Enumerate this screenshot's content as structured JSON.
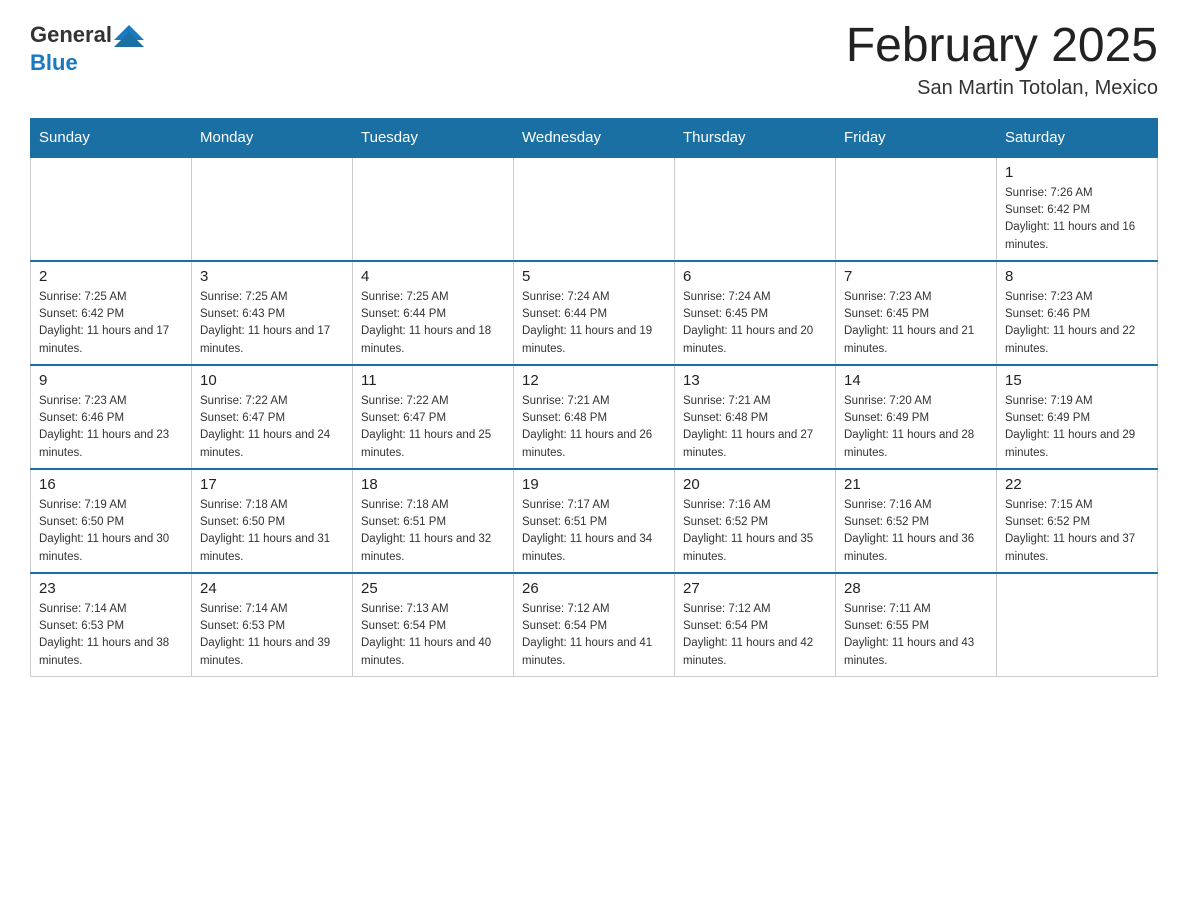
{
  "header": {
    "logo_general": "General",
    "logo_blue": "Blue",
    "month": "February 2025",
    "location": "San Martin Totolan, Mexico"
  },
  "weekdays": [
    "Sunday",
    "Monday",
    "Tuesday",
    "Wednesday",
    "Thursday",
    "Friday",
    "Saturday"
  ],
  "weeks": [
    [
      {
        "day": "",
        "sunrise": "",
        "sunset": "",
        "daylight": ""
      },
      {
        "day": "",
        "sunrise": "",
        "sunset": "",
        "daylight": ""
      },
      {
        "day": "",
        "sunrise": "",
        "sunset": "",
        "daylight": ""
      },
      {
        "day": "",
        "sunrise": "",
        "sunset": "",
        "daylight": ""
      },
      {
        "day": "",
        "sunrise": "",
        "sunset": "",
        "daylight": ""
      },
      {
        "day": "",
        "sunrise": "",
        "sunset": "",
        "daylight": ""
      },
      {
        "day": "1",
        "sunrise": "Sunrise: 7:26 AM",
        "sunset": "Sunset: 6:42 PM",
        "daylight": "Daylight: 11 hours and 16 minutes."
      }
    ],
    [
      {
        "day": "2",
        "sunrise": "Sunrise: 7:25 AM",
        "sunset": "Sunset: 6:42 PM",
        "daylight": "Daylight: 11 hours and 17 minutes."
      },
      {
        "day": "3",
        "sunrise": "Sunrise: 7:25 AM",
        "sunset": "Sunset: 6:43 PM",
        "daylight": "Daylight: 11 hours and 17 minutes."
      },
      {
        "day": "4",
        "sunrise": "Sunrise: 7:25 AM",
        "sunset": "Sunset: 6:44 PM",
        "daylight": "Daylight: 11 hours and 18 minutes."
      },
      {
        "day": "5",
        "sunrise": "Sunrise: 7:24 AM",
        "sunset": "Sunset: 6:44 PM",
        "daylight": "Daylight: 11 hours and 19 minutes."
      },
      {
        "day": "6",
        "sunrise": "Sunrise: 7:24 AM",
        "sunset": "Sunset: 6:45 PM",
        "daylight": "Daylight: 11 hours and 20 minutes."
      },
      {
        "day": "7",
        "sunrise": "Sunrise: 7:23 AM",
        "sunset": "Sunset: 6:45 PM",
        "daylight": "Daylight: 11 hours and 21 minutes."
      },
      {
        "day": "8",
        "sunrise": "Sunrise: 7:23 AM",
        "sunset": "Sunset: 6:46 PM",
        "daylight": "Daylight: 11 hours and 22 minutes."
      }
    ],
    [
      {
        "day": "9",
        "sunrise": "Sunrise: 7:23 AM",
        "sunset": "Sunset: 6:46 PM",
        "daylight": "Daylight: 11 hours and 23 minutes."
      },
      {
        "day": "10",
        "sunrise": "Sunrise: 7:22 AM",
        "sunset": "Sunset: 6:47 PM",
        "daylight": "Daylight: 11 hours and 24 minutes."
      },
      {
        "day": "11",
        "sunrise": "Sunrise: 7:22 AM",
        "sunset": "Sunset: 6:47 PM",
        "daylight": "Daylight: 11 hours and 25 minutes."
      },
      {
        "day": "12",
        "sunrise": "Sunrise: 7:21 AM",
        "sunset": "Sunset: 6:48 PM",
        "daylight": "Daylight: 11 hours and 26 minutes."
      },
      {
        "day": "13",
        "sunrise": "Sunrise: 7:21 AM",
        "sunset": "Sunset: 6:48 PM",
        "daylight": "Daylight: 11 hours and 27 minutes."
      },
      {
        "day": "14",
        "sunrise": "Sunrise: 7:20 AM",
        "sunset": "Sunset: 6:49 PM",
        "daylight": "Daylight: 11 hours and 28 minutes."
      },
      {
        "day": "15",
        "sunrise": "Sunrise: 7:19 AM",
        "sunset": "Sunset: 6:49 PM",
        "daylight": "Daylight: 11 hours and 29 minutes."
      }
    ],
    [
      {
        "day": "16",
        "sunrise": "Sunrise: 7:19 AM",
        "sunset": "Sunset: 6:50 PM",
        "daylight": "Daylight: 11 hours and 30 minutes."
      },
      {
        "day": "17",
        "sunrise": "Sunrise: 7:18 AM",
        "sunset": "Sunset: 6:50 PM",
        "daylight": "Daylight: 11 hours and 31 minutes."
      },
      {
        "day": "18",
        "sunrise": "Sunrise: 7:18 AM",
        "sunset": "Sunset: 6:51 PM",
        "daylight": "Daylight: 11 hours and 32 minutes."
      },
      {
        "day": "19",
        "sunrise": "Sunrise: 7:17 AM",
        "sunset": "Sunset: 6:51 PM",
        "daylight": "Daylight: 11 hours and 34 minutes."
      },
      {
        "day": "20",
        "sunrise": "Sunrise: 7:16 AM",
        "sunset": "Sunset: 6:52 PM",
        "daylight": "Daylight: 11 hours and 35 minutes."
      },
      {
        "day": "21",
        "sunrise": "Sunrise: 7:16 AM",
        "sunset": "Sunset: 6:52 PM",
        "daylight": "Daylight: 11 hours and 36 minutes."
      },
      {
        "day": "22",
        "sunrise": "Sunrise: 7:15 AM",
        "sunset": "Sunset: 6:52 PM",
        "daylight": "Daylight: 11 hours and 37 minutes."
      }
    ],
    [
      {
        "day": "23",
        "sunrise": "Sunrise: 7:14 AM",
        "sunset": "Sunset: 6:53 PM",
        "daylight": "Daylight: 11 hours and 38 minutes."
      },
      {
        "day": "24",
        "sunrise": "Sunrise: 7:14 AM",
        "sunset": "Sunset: 6:53 PM",
        "daylight": "Daylight: 11 hours and 39 minutes."
      },
      {
        "day": "25",
        "sunrise": "Sunrise: 7:13 AM",
        "sunset": "Sunset: 6:54 PM",
        "daylight": "Daylight: 11 hours and 40 minutes."
      },
      {
        "day": "26",
        "sunrise": "Sunrise: 7:12 AM",
        "sunset": "Sunset: 6:54 PM",
        "daylight": "Daylight: 11 hours and 41 minutes."
      },
      {
        "day": "27",
        "sunrise": "Sunrise: 7:12 AM",
        "sunset": "Sunset: 6:54 PM",
        "daylight": "Daylight: 11 hours and 42 minutes."
      },
      {
        "day": "28",
        "sunrise": "Sunrise: 7:11 AM",
        "sunset": "Sunset: 6:55 PM",
        "daylight": "Daylight: 11 hours and 43 minutes."
      },
      {
        "day": "",
        "sunrise": "",
        "sunset": "",
        "daylight": ""
      }
    ]
  ]
}
